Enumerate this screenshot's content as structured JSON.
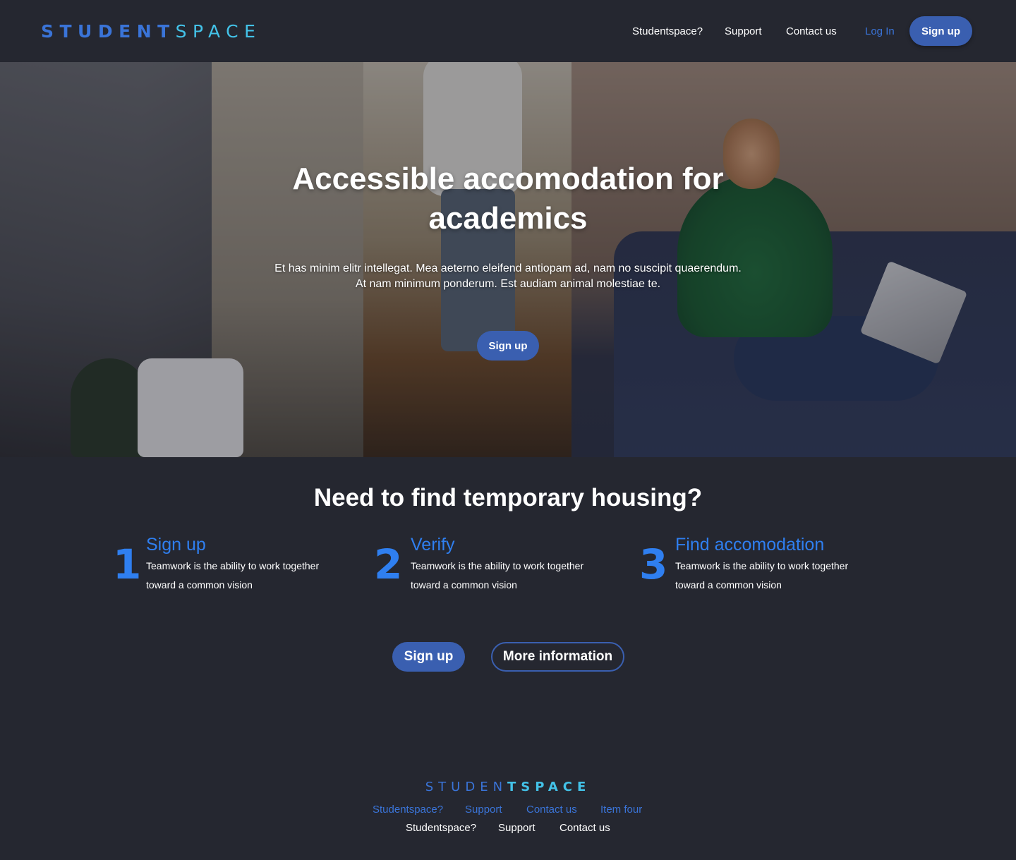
{
  "header": {
    "logo_part1": "STUDENT",
    "logo_part2": "SPACE",
    "nav": [
      {
        "label": "Studentspace?"
      },
      {
        "label": "Support"
      },
      {
        "label": "Contact us"
      }
    ],
    "login_label": "Log In",
    "signup_label": "Sign up"
  },
  "hero": {
    "title_line1": "Accessible accomodation for",
    "title_line2": "academics",
    "text_line1": "Et has minim elitr intellegat. Mea aeterno eleifend antiopam ad, nam no suscipit quaerendum.",
    "text_line2": "At nam minimum ponderum. Est audiam animal molestiae te.",
    "button_label": "Sign up"
  },
  "steps": {
    "title": "Need to find temporary housing?",
    "items": [
      {
        "number": "1",
        "title": "Sign up",
        "desc": "Teamwork is the ability to work together toward a common vision"
      },
      {
        "number": "2",
        "title": "Verify",
        "desc": "Teamwork is the ability to work together toward a common vision"
      },
      {
        "number": "3",
        "title": "Find accomodation",
        "desc": "Teamwork is the ability to work together toward a common vision"
      }
    ],
    "signup_label": "Sign up",
    "more_label": "More information"
  },
  "footer": {
    "logo_part1": "STUDEN",
    "logo_part2": "TSPACE",
    "links_row1": [
      {
        "label": "Studentspace?"
      },
      {
        "label": "Support"
      },
      {
        "label": "Contact us"
      },
      {
        "label": "Item four"
      }
    ],
    "links_row2": [
      {
        "label": "Studentspace?"
      },
      {
        "label": "Support"
      },
      {
        "label": "Contact us"
      }
    ]
  },
  "colors": {
    "background": "#252730",
    "accent_blue": "#3a5fb0",
    "link_blue": "#3a74d8",
    "step_blue": "#2f7ff0",
    "logo_cyan": "#43c2e8"
  }
}
